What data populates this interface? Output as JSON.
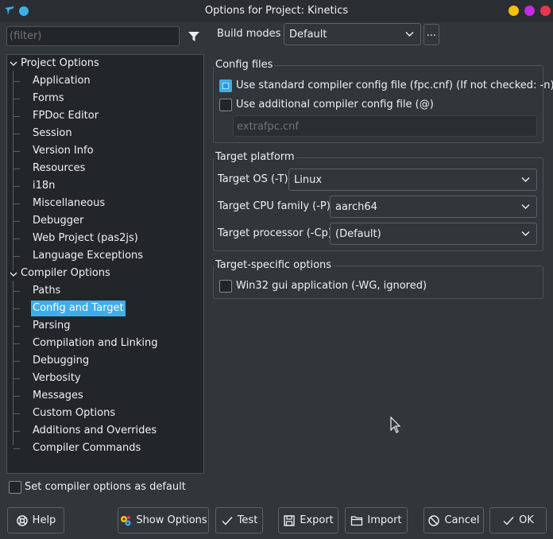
{
  "window": {
    "title": "Options for Project: Kinetics"
  },
  "filter": {
    "placeholder": "(filter)"
  },
  "tree": {
    "project_options": {
      "label": "Project Options",
      "items": [
        "Application",
        "Forms",
        "FPDoc Editor",
        "Session",
        "Version Info",
        "Resources",
        "i18n",
        "Miscellaneous",
        "Debugger",
        "Web Project (pas2js)",
        "Language Exceptions"
      ]
    },
    "compiler_options": {
      "label": "Compiler Options",
      "items": [
        "Paths",
        "Config and Target",
        "Parsing",
        "Compilation and Linking",
        "Debugging",
        "Verbosity",
        "Messages",
        "Custom Options",
        "Additions and Overrides",
        "Compiler Commands"
      ],
      "selected": "Config and Target"
    }
  },
  "build_modes": {
    "label": "Build modes",
    "value": "Default",
    "more_label": "..."
  },
  "config_files": {
    "title": "Config files",
    "use_standard": {
      "label": "Use standard compiler config file (fpc.cnf) (If not checked: -n)",
      "checked": true
    },
    "use_additional": {
      "label": "Use additional compiler config file (@)",
      "checked": false
    },
    "additional_file": "extrafpc.cnf"
  },
  "target_platform": {
    "title": "Target platform",
    "os": {
      "label": "Target OS (-T)",
      "value": "Linux"
    },
    "cpu": {
      "label": "Target CPU family (-P)",
      "value": "aarch64"
    },
    "processor": {
      "label": "Target processor (-Cp)",
      "value": "(Default)"
    }
  },
  "target_specific": {
    "title": "Target-specific options",
    "win32_gui": {
      "label": "Win32 gui application (-WG, ignored)",
      "checked": false
    }
  },
  "set_default": {
    "label": "Set compiler options as default",
    "checked": false
  },
  "buttons": {
    "help": "Help",
    "show_options": "Show Options",
    "test": "Test",
    "export": "Export",
    "import": "Import",
    "cancel": "Cancel",
    "ok": "OK"
  },
  "colors": {
    "accent": "#3daee9",
    "window_yellow": "#f4c20d",
    "window_magenta": "#c42be3",
    "window_red": "#e7384f"
  }
}
